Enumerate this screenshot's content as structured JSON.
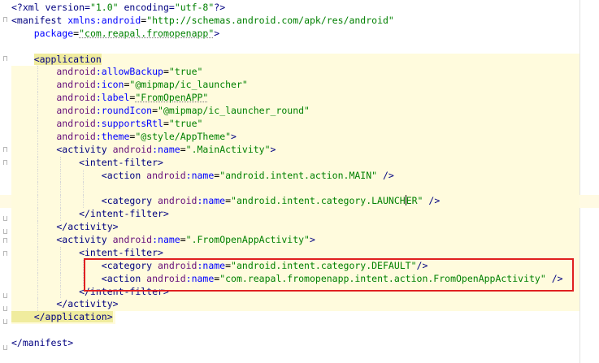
{
  "editor": {
    "lines": [
      {
        "t": [
          [
            "<?xml version=",
            "tag"
          ],
          [
            "\"1.0\"",
            "val"
          ],
          [
            " encoding=",
            "tag"
          ],
          [
            "\"utf-8\"",
            "val"
          ],
          [
            "?>",
            "tag"
          ]
        ]
      },
      {
        "t": [
          [
            "<manifest ",
            "tag"
          ],
          [
            "xmlns:android",
            "attr"
          ],
          [
            "=",
            ""
          ],
          [
            "\"http://schemas.android.com/apk/res/android\"",
            "val"
          ]
        ]
      },
      {
        "t": [
          [
            "    package",
            "attr"
          ],
          [
            "=",
            ""
          ],
          [
            "\"com.reapal.fromopenapp\"",
            "val"
          ],
          [
            ">",
            "tag"
          ]
        ]
      },
      {
        "t": [
          [
            "",
            ""
          ]
        ]
      },
      {
        "t": [
          [
            "    ",
            ""
          ],
          [
            "<application",
            "tag"
          ]
        ]
      },
      {
        "t": [
          [
            "        android",
            "ns"
          ],
          [
            ":allowBackup",
            "attr"
          ],
          [
            "=",
            ""
          ],
          [
            "\"true\"",
            "val"
          ]
        ]
      },
      {
        "t": [
          [
            "        android",
            "ns"
          ],
          [
            ":icon",
            "attr"
          ],
          [
            "=",
            ""
          ],
          [
            "\"@mipmap/ic_launcher\"",
            "val"
          ]
        ]
      },
      {
        "t": [
          [
            "        android",
            "ns"
          ],
          [
            ":label",
            "attr"
          ],
          [
            "=",
            ""
          ],
          [
            "\"FromOpenAPP\"",
            "val"
          ]
        ]
      },
      {
        "t": [
          [
            "        android",
            "ns"
          ],
          [
            ":roundIcon",
            "attr"
          ],
          [
            "=",
            ""
          ],
          [
            "\"@mipmap/ic_launcher_round\"",
            "val"
          ]
        ]
      },
      {
        "t": [
          [
            "        android",
            "ns"
          ],
          [
            ":supportsRtl",
            "attr"
          ],
          [
            "=",
            ""
          ],
          [
            "\"true\"",
            "val"
          ]
        ]
      },
      {
        "t": [
          [
            "        android",
            "ns"
          ],
          [
            ":theme",
            "attr"
          ],
          [
            "=",
            ""
          ],
          [
            "\"@style/AppTheme\"",
            "val"
          ],
          [
            ">",
            "tag"
          ]
        ]
      },
      {
        "t": [
          [
            "        <activity ",
            "tag"
          ],
          [
            "android",
            "ns"
          ],
          [
            ":name",
            "attr"
          ],
          [
            "=",
            ""
          ],
          [
            "\".MainActivity\"",
            "val"
          ],
          [
            ">",
            "tag"
          ]
        ]
      },
      {
        "t": [
          [
            "            <intent-filter>",
            "tag"
          ]
        ]
      },
      {
        "t": [
          [
            "                <action ",
            "tag"
          ],
          [
            "android",
            "ns"
          ],
          [
            ":name",
            "attr"
          ],
          [
            "=",
            ""
          ],
          [
            "\"android.intent.action.MAIN\"",
            "val"
          ],
          [
            " />",
            "tag"
          ]
        ]
      },
      {
        "t": [
          [
            "",
            ""
          ]
        ]
      },
      {
        "t": [
          [
            "                <category ",
            "tag"
          ],
          [
            "android",
            "ns"
          ],
          [
            ":name",
            "attr"
          ],
          [
            "=",
            ""
          ],
          [
            "\"android.intent.category.LAUNCHER\"",
            "val"
          ],
          [
            " />",
            "tag"
          ]
        ]
      },
      {
        "t": [
          [
            "            </intent-filter>",
            "tag"
          ]
        ]
      },
      {
        "t": [
          [
            "        </activity>",
            "tag"
          ]
        ]
      },
      {
        "t": [
          [
            "        <activity ",
            "tag"
          ],
          [
            "android",
            "ns"
          ],
          [
            ":name",
            "attr"
          ],
          [
            "=",
            ""
          ],
          [
            "\".FromOpenAppActivity\"",
            "val"
          ],
          [
            ">",
            "tag"
          ]
        ]
      },
      {
        "t": [
          [
            "            <intent-filter>",
            "tag"
          ]
        ]
      },
      {
        "t": [
          [
            "                <category ",
            "tag"
          ],
          [
            "android",
            "ns"
          ],
          [
            ":name",
            "attr"
          ],
          [
            "=",
            ""
          ],
          [
            "\"android.intent.category.DEFAULT\"",
            "val"
          ],
          [
            "/>",
            "tag"
          ]
        ]
      },
      {
        "t": [
          [
            "                <action ",
            "tag"
          ],
          [
            "android",
            "ns"
          ],
          [
            ":name",
            "attr"
          ],
          [
            "=",
            ""
          ],
          [
            "\"com.reapal.fromopenapp.intent.action.FromOpenAppActivity\"",
            "val"
          ],
          [
            " />",
            "tag"
          ]
        ]
      },
      {
        "t": [
          [
            "            </intent-filter>",
            "tag"
          ]
        ]
      },
      {
        "t": [
          [
            "        </activity>",
            "tag"
          ]
        ]
      },
      {
        "t": [
          [
            "    </application>",
            "tag"
          ]
        ]
      },
      {
        "t": [
          [
            "",
            ""
          ]
        ]
      },
      {
        "t": [
          [
            "</manifest>",
            "tag"
          ]
        ]
      }
    ]
  },
  "colors": {
    "tag": "#000080",
    "attribute": "#0000ff",
    "namespace": "#660e7a",
    "value": "#008000",
    "highlight_block": "#fffbdd",
    "annotation_box": "#e02020"
  }
}
